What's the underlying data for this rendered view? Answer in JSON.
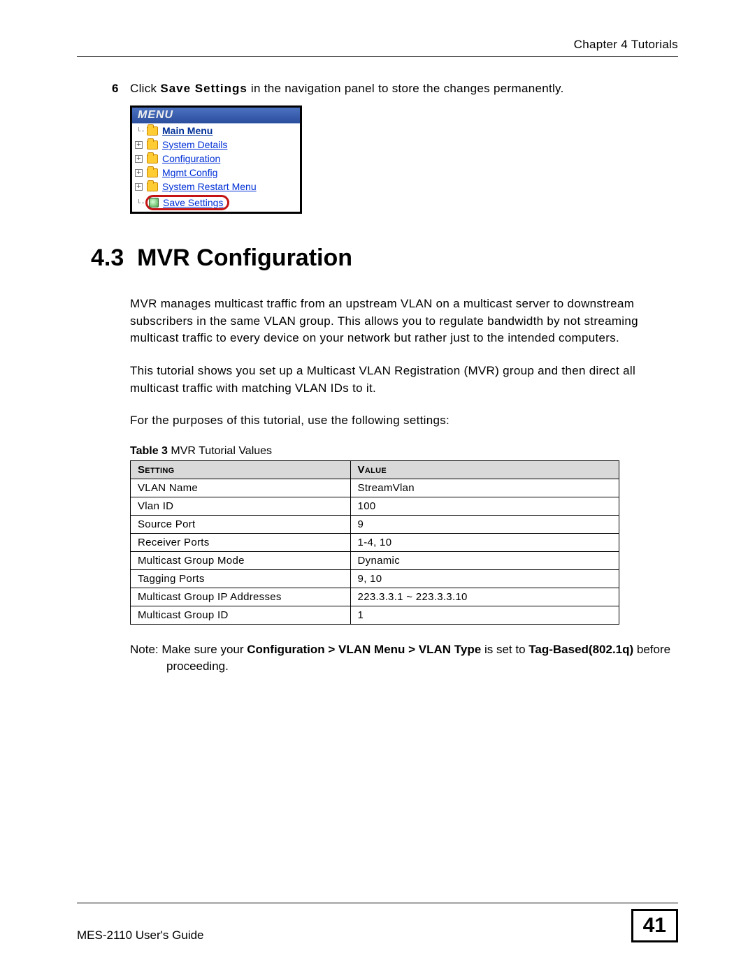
{
  "header": {
    "chapter": "Chapter 4 Tutorials"
  },
  "step": {
    "number": "6",
    "pre": "Click ",
    "bold": "Save Settings",
    "post": " in the navigation panel to store the changes permanently."
  },
  "menu": {
    "title": "MENU",
    "items": [
      {
        "label": "Main Menu",
        "kind": "main"
      },
      {
        "label": "System Details",
        "kind": "exp"
      },
      {
        "label": "Configuration",
        "kind": "exp"
      },
      {
        "label": "Mgmt Config",
        "kind": "exp"
      },
      {
        "label": "System Restart Menu",
        "kind": "exp"
      },
      {
        "label": "Save Settings",
        "kind": "save"
      }
    ]
  },
  "section": {
    "number": "4.3",
    "title": "MVR Configuration"
  },
  "paragraphs": {
    "p1": "MVR manages multicast traffic from an upstream VLAN on a multicast server to downstream subscribers in the same VLAN group. This allows you to regulate bandwidth by not streaming multicast traffic to every device on your network but rather just to the intended computers.",
    "p2": "This tutorial shows you set up a Multicast VLAN Registration (MVR) group and then direct all multicast traffic with matching VLAN IDs to it.",
    "p3": "For the purposes of this tutorial, use the following settings:"
  },
  "table": {
    "caption_bold": "Table 3",
    "caption_rest": "   MVR Tutorial Values",
    "headers": {
      "setting": "Setting",
      "value": "Value"
    },
    "rows": [
      {
        "setting": "VLAN Name",
        "value": "StreamVlan"
      },
      {
        "setting": "Vlan ID",
        "value": "100"
      },
      {
        "setting": "Source Port",
        "value": "9"
      },
      {
        "setting": "Receiver Ports",
        "value": "1-4, 10"
      },
      {
        "setting": "Multicast Group Mode",
        "value": "Dynamic"
      },
      {
        "setting": "Tagging Ports",
        "value": "9, 10"
      },
      {
        "setting": "Multicast Group IP Addresses",
        "value": "223.3.3.1 ~ 223.3.3.10"
      },
      {
        "setting": "Multicast Group ID",
        "value": "1"
      }
    ]
  },
  "note": {
    "lead": "Note: ",
    "t1": "Make sure your ",
    "b1": "Configuration > VLAN Menu > VLAN Type",
    "t2": " is set to ",
    "b2": "Tag-Based(802.1q)",
    "t3": " before proceeding."
  },
  "footer": {
    "guide": "MES-2110 User's Guide",
    "page": "41"
  }
}
